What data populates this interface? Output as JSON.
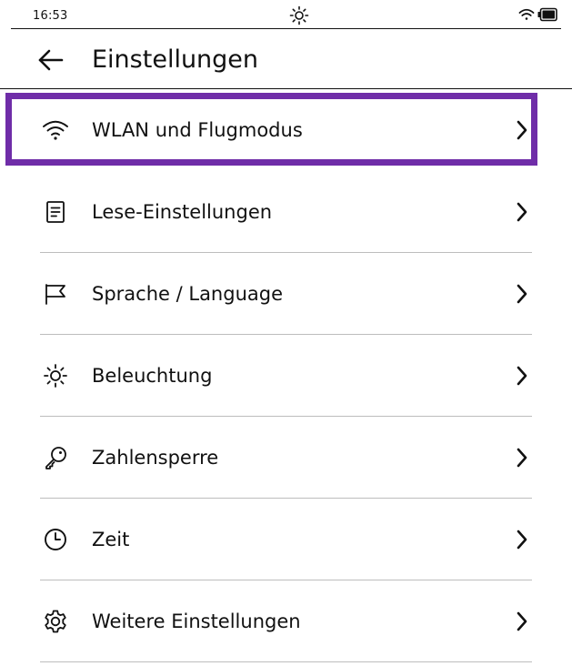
{
  "status_bar": {
    "time": "16:53",
    "center_icon": "sun-icon",
    "right_icons": [
      "wifi-icon",
      "battery-icon"
    ]
  },
  "header": {
    "back_icon": "arrow-left-icon",
    "title": "Einstellungen"
  },
  "colors": {
    "selection_frame": "#6f2da8",
    "text": "#111111",
    "divider": "#bdbdbd",
    "background": "#ffffff"
  },
  "settings": {
    "items": [
      {
        "icon": "wifi-icon",
        "label": "WLAN und Flugmodus",
        "chevron": "chevron-right-icon",
        "selected": true
      },
      {
        "icon": "document-icon",
        "label": "Lese-Einstellungen",
        "chevron": "chevron-right-icon",
        "selected": false
      },
      {
        "icon": "flag-icon",
        "label": "Sprache / Language",
        "chevron": "chevron-right-icon",
        "selected": false
      },
      {
        "icon": "sun-icon",
        "label": "Beleuchtung",
        "chevron": "chevron-right-icon",
        "selected": false
      },
      {
        "icon": "key-icon",
        "label": "Zahlensperre",
        "chevron": "chevron-right-icon",
        "selected": false
      },
      {
        "icon": "clock-icon",
        "label": "Zeit",
        "chevron": "chevron-right-icon",
        "selected": false
      },
      {
        "icon": "gear-icon",
        "label": "Weitere Einstellungen",
        "chevron": "chevron-right-icon",
        "selected": false
      }
    ]
  }
}
